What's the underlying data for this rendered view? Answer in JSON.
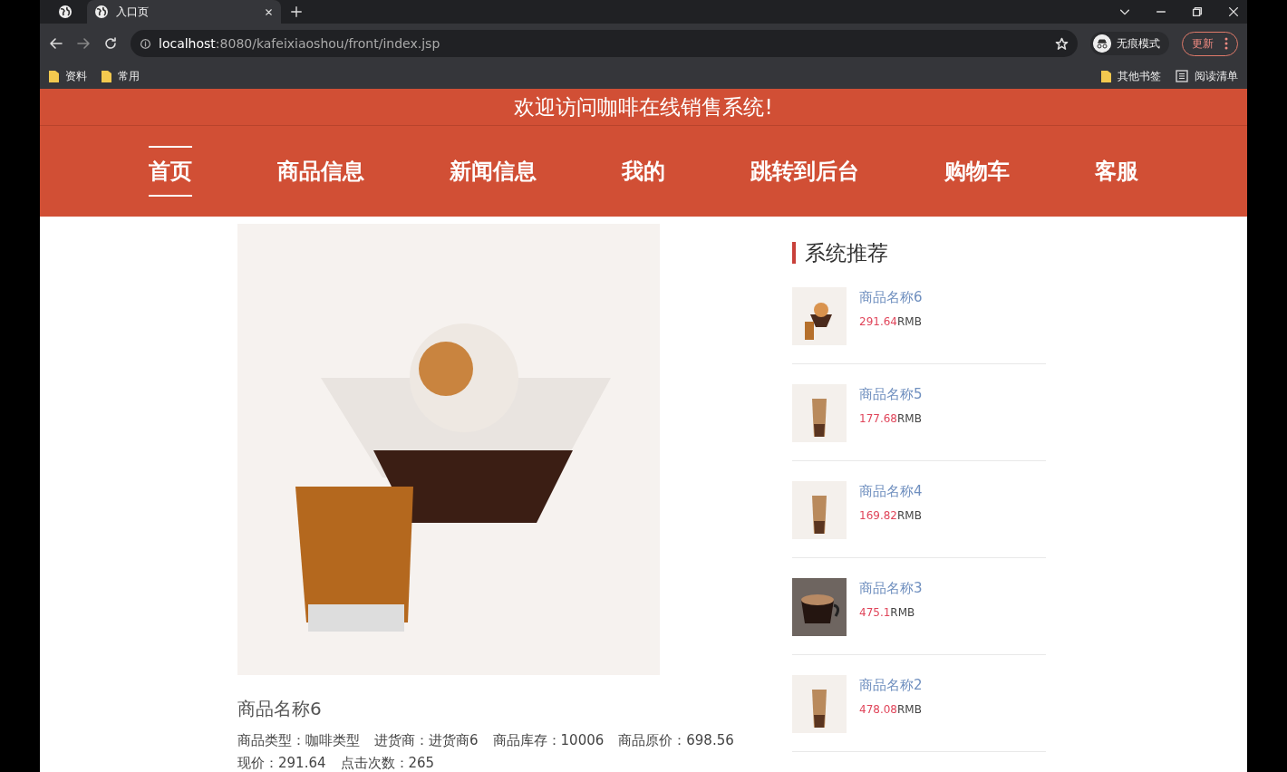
{
  "browser": {
    "tabs": [
      {
        "label": "入口页",
        "selected": true
      }
    ],
    "address": {
      "host": "localhost",
      "path": ":8080/kafeixiaoshou/front/index.jsp"
    },
    "profile": "无痕模式",
    "update_button": "更新",
    "bookmarks": [
      {
        "label": "资料",
        "kind": "folder"
      },
      {
        "label": "常用",
        "kind": "folder"
      }
    ],
    "bookmarks_right": [
      {
        "label": "其他书签",
        "kind": "folder"
      },
      {
        "label": "阅读清单",
        "kind": "list"
      }
    ]
  },
  "site": {
    "title": "欢迎访问咖啡在线销售系统!",
    "nav": [
      {
        "label": "首页",
        "selected": true
      },
      {
        "label": "商品信息",
        "selected": false
      },
      {
        "label": "新闻信息",
        "selected": false
      },
      {
        "label": "我的",
        "selected": false
      },
      {
        "label": "跳转到后台",
        "selected": false
      },
      {
        "label": "购物车",
        "selected": false
      },
      {
        "label": "客服",
        "selected": false
      }
    ]
  },
  "product": {
    "name": "商品名称6",
    "details": [
      {
        "label": "商品类型：",
        "value": "咖啡类型"
      },
      {
        "label": "进货商：",
        "value": "进货商6"
      },
      {
        "label": "商品库存：",
        "value": "10006"
      },
      {
        "label": "商品原价：",
        "value": "698.56"
      },
      {
        "label": "现价：",
        "value": "291.64"
      },
      {
        "label": "点击次数：",
        "value": "265"
      }
    ]
  },
  "recommend": {
    "title": "系统推荐",
    "items": [
      {
        "name": "商品名称6",
        "price": "291.64",
        "unit": "RMB",
        "kind": "dessert"
      },
      {
        "name": "商品名称5",
        "price": "177.68",
        "unit": "RMB",
        "kind": "tall"
      },
      {
        "name": "商品名称4",
        "price": "169.82",
        "unit": "RMB",
        "kind": "tall"
      },
      {
        "name": "商品名称3",
        "price": "475.1",
        "unit": "RMB",
        "kind": "cup"
      },
      {
        "name": "商品名称2",
        "price": "478.08",
        "unit": "RMB",
        "kind": "tall"
      }
    ]
  }
}
